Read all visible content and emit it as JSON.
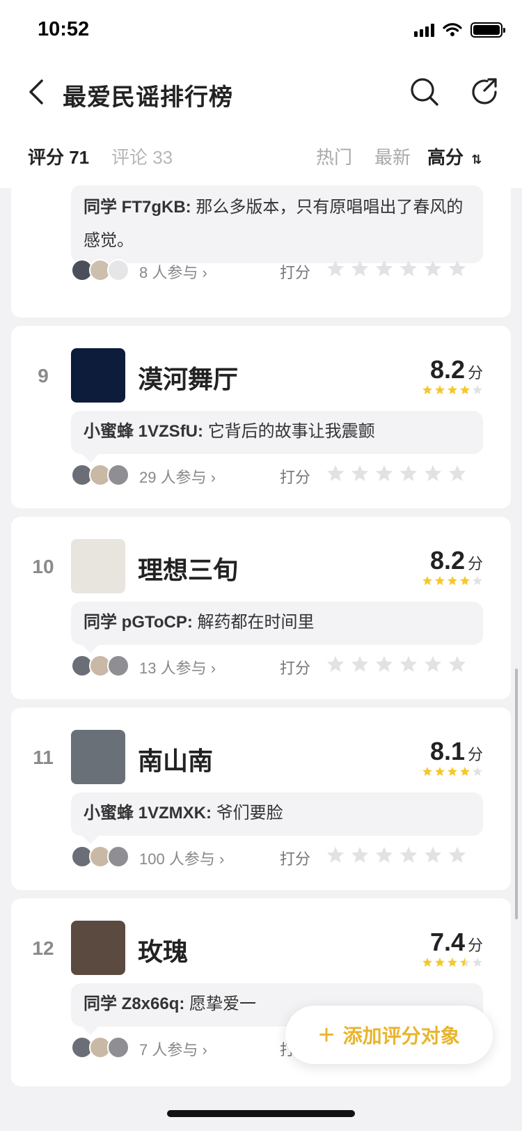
{
  "status": {
    "time": "10:52"
  },
  "nav": {
    "title": "最爱民谣排行榜"
  },
  "tabs": {
    "ratings": "评分 71",
    "comments": "评论 33",
    "sort_hot": "热门",
    "sort_new": "最新",
    "sort_high": "高分"
  },
  "first_partial": {
    "comment_user": "同学 FT7gKB:",
    "comment_text": "那么多版本，只有原唱唱出了春风的感觉。",
    "participants": "8 人参与",
    "rate_label": "打分"
  },
  "items": [
    {
      "rank": "9",
      "title": "漠河舞厅",
      "score": "8.2",
      "unit": "分",
      "rating_stars": 4,
      "comment_user": "小蜜蜂 1VZSfU:",
      "comment_text": "它背后的故事让我震颤",
      "participants": "29 人参与",
      "rate_label": "打分",
      "cover_color": "#0c1c3a"
    },
    {
      "rank": "10",
      "title": "理想三旬",
      "score": "8.2",
      "unit": "分",
      "rating_stars": 4,
      "comment_user": "同学 pGToCP:",
      "comment_text": "解药都在时间里",
      "participants": "13 人参与",
      "rate_label": "打分",
      "cover_color": "#e7e5dd"
    },
    {
      "rank": "11",
      "title": "南山南",
      "score": "8.1",
      "unit": "分",
      "rating_stars": 4,
      "comment_user": "小蜜蜂 1VZMXK:",
      "comment_text": "爷们要脸",
      "participants": "100 人参与",
      "rate_label": "打分",
      "cover_color": "#6a7078"
    },
    {
      "rank": "12",
      "title": "玫瑰",
      "score": "7.4",
      "unit": "分",
      "rating_stars": 3.5,
      "comment_user": "同学 Z8x66q:",
      "comment_text": "愿挚爱一",
      "participants": "7 人参与",
      "rate_label": "打分",
      "cover_color": "#5b4a40"
    }
  ],
  "fab": {
    "label": "添加评分对象"
  },
  "colors": {
    "accent": "#e9b42c",
    "star_filled": "#f5c82a",
    "star_empty": "#e2e2e4"
  }
}
